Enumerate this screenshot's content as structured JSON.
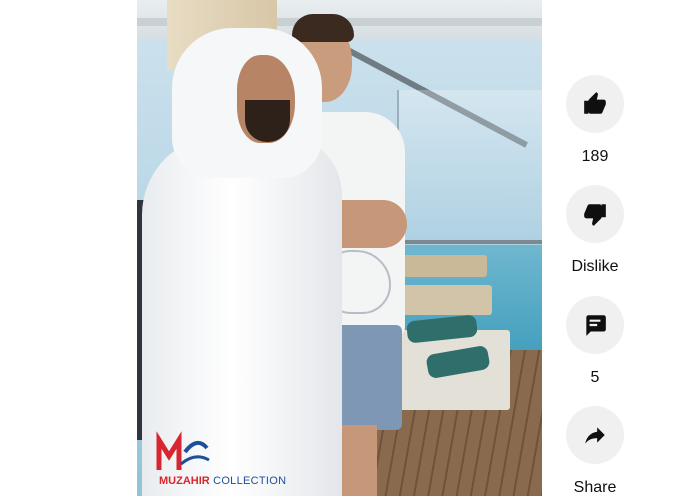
{
  "actions": {
    "like": {
      "label": "189",
      "icon": "thumbs-up-icon"
    },
    "dislike": {
      "label": "Dislike",
      "icon": "thumbs-down-icon"
    },
    "comments": {
      "label": "5",
      "icon": "comment-icon"
    },
    "share": {
      "label": "Share",
      "icon": "share-icon"
    }
  },
  "watermark": {
    "part1": "MUZAHIR",
    "part2": " COLLECTION"
  },
  "colors": {
    "button_bg": "#f0f0f0",
    "icon": "#0f0f0f",
    "text": "#0f0f0f"
  }
}
